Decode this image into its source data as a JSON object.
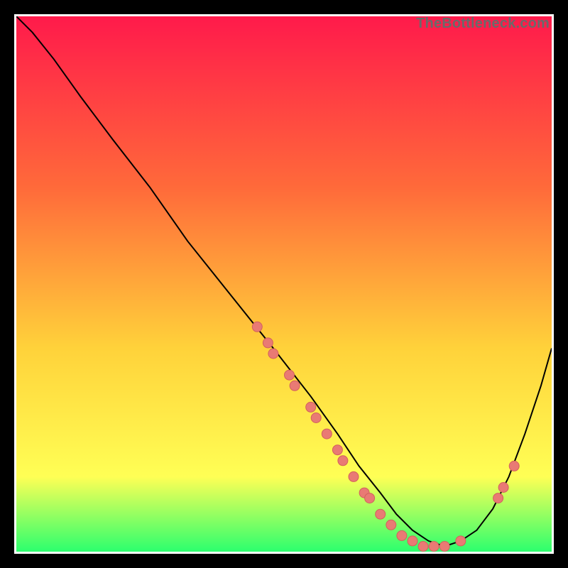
{
  "watermark": {
    "text": "TheBottleneck.com"
  },
  "colors": {
    "grad_top": "#ff1a4b",
    "grad_mid1": "#ff6a3a",
    "grad_mid2": "#ffd23a",
    "grad_mid3": "#ffff55",
    "grad_bottom": "#2cff6e",
    "curve": "#000000",
    "marker_fill": "#e97a74",
    "marker_stroke": "#d2615c"
  },
  "chart_data": {
    "type": "line",
    "title": "",
    "xlabel": "",
    "ylabel": "",
    "xlim": [
      0,
      100
    ],
    "ylim": [
      0,
      100
    ],
    "grid": false,
    "legend": false,
    "series": [
      {
        "name": "performance-curve",
        "x": [
          0,
          3,
          7,
          12,
          18,
          25,
          32,
          40,
          48,
          55,
          60,
          64,
          68,
          71,
          74,
          77,
          80,
          83,
          86,
          89,
          92,
          95,
          98,
          100
        ],
        "values": [
          100,
          97,
          92,
          85,
          77,
          68,
          58,
          48,
          38,
          29,
          22,
          16,
          11,
          7,
          4,
          2,
          1,
          2,
          4,
          8,
          14,
          22,
          31,
          38
        ]
      }
    ],
    "markers": [
      {
        "x": 45,
        "y": 42
      },
      {
        "x": 47,
        "y": 39
      },
      {
        "x": 48,
        "y": 37
      },
      {
        "x": 51,
        "y": 33
      },
      {
        "x": 52,
        "y": 31
      },
      {
        "x": 55,
        "y": 27
      },
      {
        "x": 56,
        "y": 25
      },
      {
        "x": 58,
        "y": 22
      },
      {
        "x": 60,
        "y": 19
      },
      {
        "x": 61,
        "y": 17
      },
      {
        "x": 63,
        "y": 14
      },
      {
        "x": 65,
        "y": 11
      },
      {
        "x": 66,
        "y": 10
      },
      {
        "x": 68,
        "y": 7
      },
      {
        "x": 70,
        "y": 5
      },
      {
        "x": 72,
        "y": 3
      },
      {
        "x": 74,
        "y": 2
      },
      {
        "x": 76,
        "y": 1
      },
      {
        "x": 78,
        "y": 1
      },
      {
        "x": 80,
        "y": 1
      },
      {
        "x": 83,
        "y": 2
      },
      {
        "x": 90,
        "y": 10
      },
      {
        "x": 91,
        "y": 12
      },
      {
        "x": 93,
        "y": 16
      }
    ]
  }
}
